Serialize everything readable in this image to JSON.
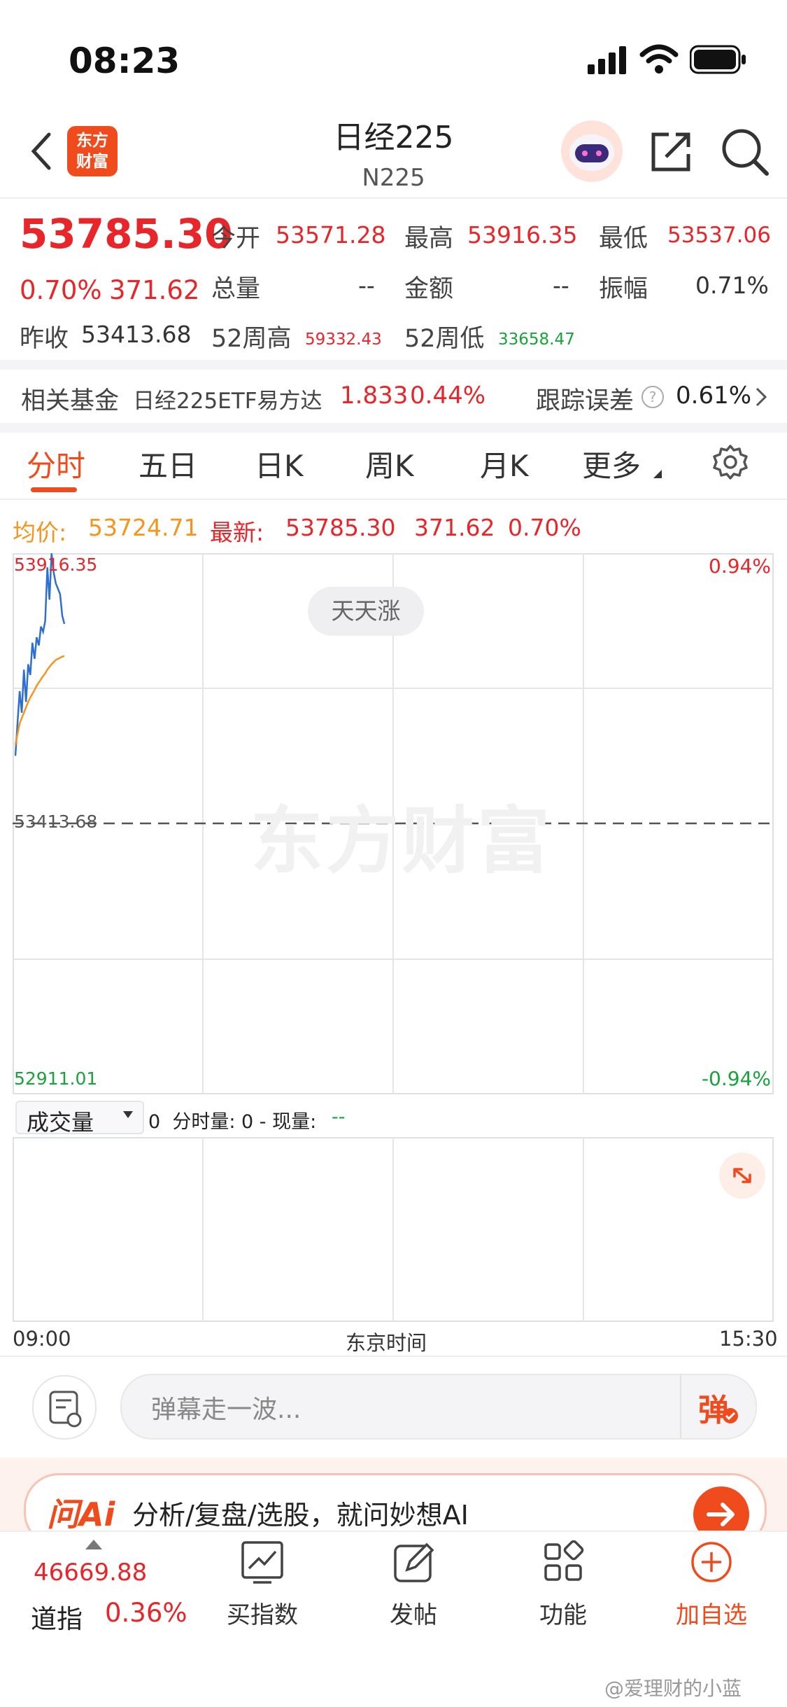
{
  "status_bar": {
    "time": "08:23"
  },
  "nav": {
    "title": "日经225",
    "subtitle": "N225",
    "logo_line1": "东方",
    "logo_line2": "财富"
  },
  "quote": {
    "price": "53785.30",
    "change_pct": "0.70%",
    "change": "371.62",
    "open_label": "今开",
    "open": "53571.28",
    "high_label": "最高",
    "high": "53916.35",
    "low_label": "最低",
    "low": "53537.06",
    "volume_label": "总量",
    "volume": "--",
    "amount_label": "金额",
    "amount": "--",
    "amplitude_label": "振幅",
    "amplitude": "0.71%",
    "prev_close_label": "昨收",
    "prev_close": "53413.68",
    "w52_high_label": "52周高",
    "w52_high": "59332.43",
    "w52_low_label": "52周低",
    "w52_low": "33658.47"
  },
  "fund": {
    "label": "相关基金",
    "name": "日经225ETF易方达",
    "price": "1.833",
    "pct": "0.44%",
    "tracking_label": "跟踪误差",
    "tracking_value": "0.61%"
  },
  "tabs": [
    "分时",
    "五日",
    "日K",
    "周K",
    "月K",
    "更多"
  ],
  "info_line": {
    "avg_label": "均价:",
    "avg": "53724.71",
    "latest_label": "最新:",
    "latest": "53785.30",
    "change": "371.62",
    "pct": "0.70%"
  },
  "chart_data": {
    "type": "line",
    "y_top_label": "53916.35",
    "y_mid_label": "53413.68",
    "y_bottom_label": "52911.01",
    "pct_top_label": "0.94%",
    "pct_bottom_label": "-0.94%",
    "ylim": [
      52911.01,
      53916.35
    ],
    "x_start_label": "09:00",
    "x_mid_label": "东京时间",
    "x_end_label": "15:30",
    "watermark": "东方财富",
    "bubble": "天天涨",
    "series": [
      {
        "color": "#2e6fd1",
        "values": [
          53540,
          53600,
          53660,
          53620,
          53700,
          53640,
          53710,
          53690,
          53750,
          53720,
          53760,
          53745,
          53780,
          53770,
          53790,
          53890,
          53830,
          53916,
          53880,
          53860,
          53850,
          53840,
          53800,
          53785
        ]
      },
      {
        "color": "#f5951d",
        "values": [
          53560,
          53580,
          53600,
          53610,
          53620,
          53630,
          53640,
          53648,
          53655,
          53662,
          53670,
          53676,
          53682,
          53688,
          53693,
          53700,
          53705,
          53710,
          53714,
          53718,
          53720,
          53722,
          53724,
          53725
        ]
      }
    ]
  },
  "volume": {
    "selector": "成交量",
    "text": "0  分时量: 0 - 现量:",
    "current": "--"
  },
  "comment": {
    "placeholder": "弹幕走一波...",
    "danmu": "弹"
  },
  "ai_banner": {
    "logo": "问Ai",
    "text": "分析/复盘/选股，就问妙想AI"
  },
  "bottom_nav": {
    "index_value": "46669.88",
    "index_name": "道指",
    "index_pct": "0.36%",
    "buy": "买指数",
    "post": "发帖",
    "func": "功能",
    "add": "加自选"
  },
  "weibo": "@爱理财的小蓝",
  "colors": {
    "up": "#e8262a",
    "down": "#19a33a",
    "accent": "#f04b1d",
    "avg": "#f5951d",
    "line": "#2e6fd1"
  }
}
